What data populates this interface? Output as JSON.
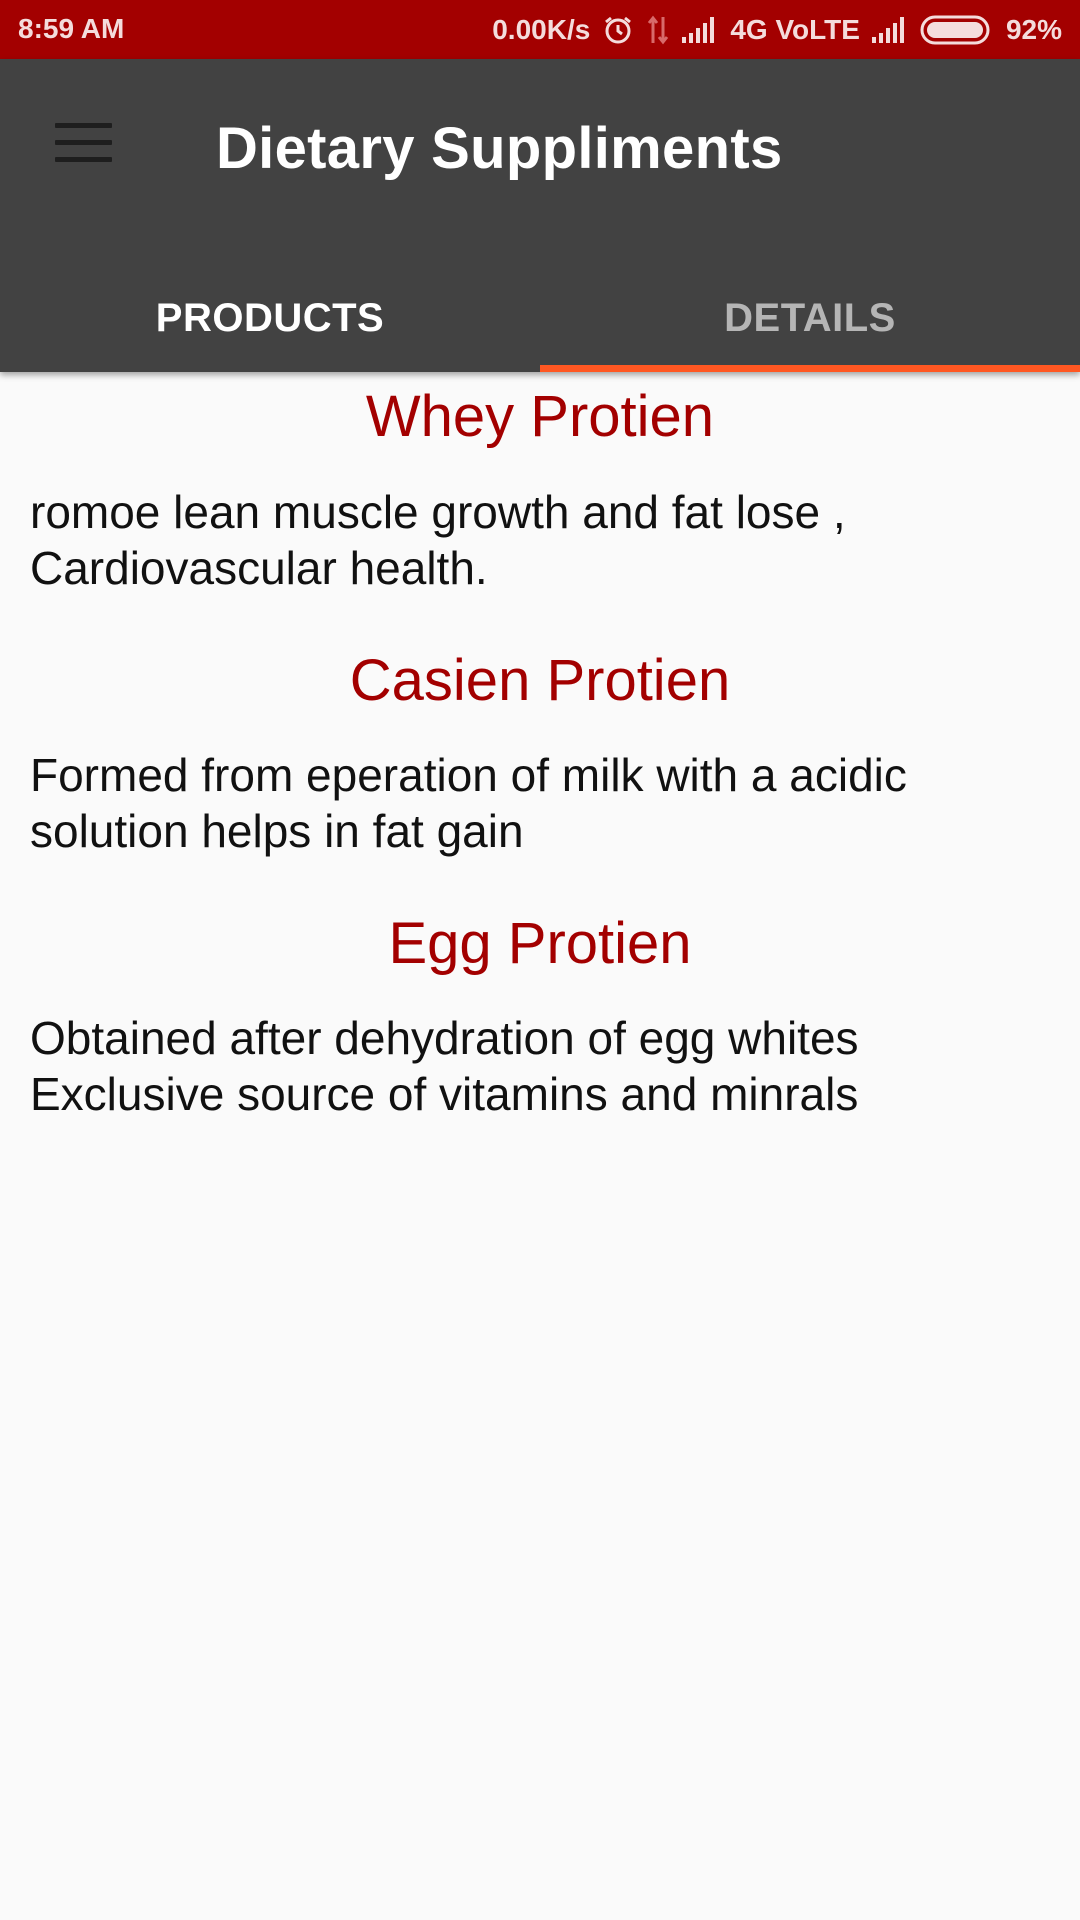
{
  "status_bar": {
    "time": "8:59 AM",
    "network_speed": "0.00K/s",
    "network_type": "4G VoLTE",
    "battery": "92%",
    "icons": [
      "alarm-icon",
      "data-arrows-icon",
      "signal-icon",
      "signal-icon",
      "battery-icon"
    ],
    "battery_level": 0.92
  },
  "app_bar": {
    "title": "Dietary Suppliments",
    "menu_icon": "hamburger-menu-icon"
  },
  "tabs": [
    {
      "label": "PRODUCTS",
      "active": false
    },
    {
      "label": "DETAILS",
      "active": true
    }
  ],
  "products": [
    {
      "name": "Whey Protien",
      "description_lines": [
        "romoe lean muscle growth and fat lose ,",
        "Cardiovascular health."
      ]
    },
    {
      "name": "Casien Protien",
      "description_lines": [
        "Formed from eperation of milk with a acidic",
        "solution helps in fat gain"
      ]
    },
    {
      "name": "Egg Protien",
      "description_lines": [
        "Obtained after dehydration of egg whites",
        "Exclusive source of vitamins and minrals"
      ]
    }
  ],
  "colors": {
    "status_bar": "#a30000",
    "app_bar": "#424242",
    "accent": "#ff5722",
    "heading": "#a30000",
    "background": "#fafafa"
  }
}
